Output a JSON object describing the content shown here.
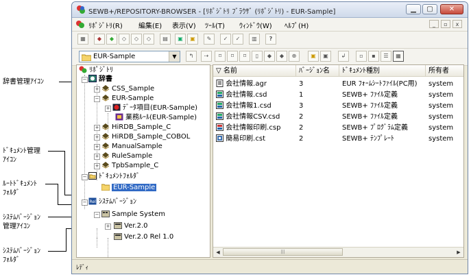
{
  "window": {
    "title": "SEWB+/REPOSITORY-BROWSER - [ﾘﾎﾟｼﾞﾄﾘ ﾌﾞﾗｳｻﾞ (ﾘﾎﾟｼﾞﾄﾘ) - EUR-Sample]"
  },
  "menu": [
    "ﾘﾎﾟｼﾞﾄﾘ(R)",
    "編集(E)",
    "表示(V)",
    "ﾂｰﾙ(T)",
    "ｳｨﾝﾄﾞｳ(W)",
    "ﾍﾙﾌﾟ(H)"
  ],
  "toolbar": {
    "combo_value": "EUR-Sample"
  },
  "tree": {
    "root": "ﾘﾎﾟｼﾞﾄﾘ",
    "dictionary": "辞書",
    "items": [
      {
        "label": "CSS_Sample",
        "level": 2,
        "exp": "+"
      },
      {
        "label": "EUR-Sample",
        "level": 2,
        "exp": "-"
      },
      {
        "label": "ﾃﾞｰﾀ項目(EUR-Sample)",
        "level": 3,
        "exp": "+"
      },
      {
        "label": "業務ﾙｰﾙ(EUR-Sample)",
        "level": 3,
        "exp": ""
      },
      {
        "label": "HiRDB_Sample_C",
        "level": 2,
        "exp": "+"
      },
      {
        "label": "HiRDB_Sample_COBOL",
        "level": 2,
        "exp": "+"
      },
      {
        "label": "ManualSample",
        "level": 2,
        "exp": "+"
      },
      {
        "label": "RuleSample",
        "level": 2,
        "exp": "+"
      },
      {
        "label": "TpbSample_C",
        "level": 2,
        "exp": "+"
      }
    ],
    "document_folder": "ﾄﾞｷｭﾒﾝﾄﾌｫﾙﾀﾞ",
    "document_child": "EUR-Sample",
    "system_version": "ｼｽﾃﾑﾊﾞｰｼﾞｮﾝ",
    "system": "Sample System",
    "versions": [
      "Ver.2.0",
      "Ver.2.0 Rel 1.0"
    ]
  },
  "list": {
    "columns": [
      "名前",
      "ﾊﾞｰｼﾞｮﾝ名",
      "ﾄﾞｷｭﾒﾝﾄ種別",
      "所有者"
    ],
    "rows": [
      {
        "name": "会社情報.agr",
        "version": "3",
        "type": "EUR ﾌｫｰﾑｼｰﾄﾌｧｲﾙ(PC用)",
        "owner": "system"
      },
      {
        "name": "会社情報.csd",
        "version": "1",
        "type": "SEWB+ ﾌｧｲﾙ定義",
        "owner": "system"
      },
      {
        "name": "会社情報1.csd",
        "version": "3",
        "type": "SEWB+ ﾌｧｲﾙ定義",
        "owner": "system"
      },
      {
        "name": "会社情報CSV.csd",
        "version": "2",
        "type": "SEWB+ ﾌｧｲﾙ定義",
        "owner": "system"
      },
      {
        "name": "会社情報印刷.csp",
        "version": "2",
        "type": "SEWB+ ﾌﾟﾛｸﾞﾗﾑ定義",
        "owner": "system"
      },
      {
        "name": "簡易印刷.cst",
        "version": "2",
        "type": "SEWB+ ﾃﾝﾌﾟﾚｰﾄ",
        "owner": "system"
      }
    ]
  },
  "status": "ﾚﾃﾞｨ",
  "callouts": {
    "dict_icon": "辞書管理ｱｲｺﾝ",
    "doc_icon": "ﾄﾞｷｭﾒﾝﾄ管理\nｱｲｺﾝ",
    "root_folder": "ﾙｰﾄﾄﾞｷｭﾒﾝﾄ\nﾌｫﾙﾀﾞ",
    "sysver_icon": "ｼｽﾃﾑﾊﾞｰｼﾞｮﾝ\n管理ｱｲｺﾝ",
    "sysver_folder": "ｼｽﾃﾑﾊﾞｰｼﾞｮﾝ\nﾌｫﾙﾀﾞ"
  }
}
